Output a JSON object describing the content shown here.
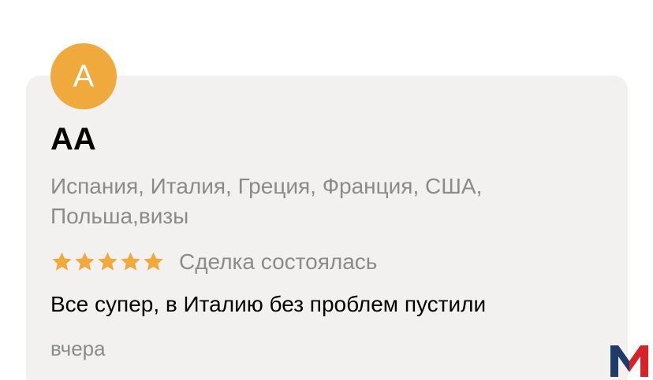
{
  "review": {
    "avatar_letter": "А",
    "avatar_color": "#efa93c",
    "reviewer_name": "АА",
    "services": "Испания, Италия, Греция, Франция, США, Польша,визы",
    "rating": 5,
    "rating_max": 5,
    "star_color": "#efa93c",
    "deal_status": "Сделка состоялась",
    "text": "Все супер, в Италию без проблем пустили",
    "date": "вчера"
  },
  "watermark": {
    "logo_letter": "M",
    "colors": [
      "#1f3b66",
      "#d6232a"
    ]
  }
}
